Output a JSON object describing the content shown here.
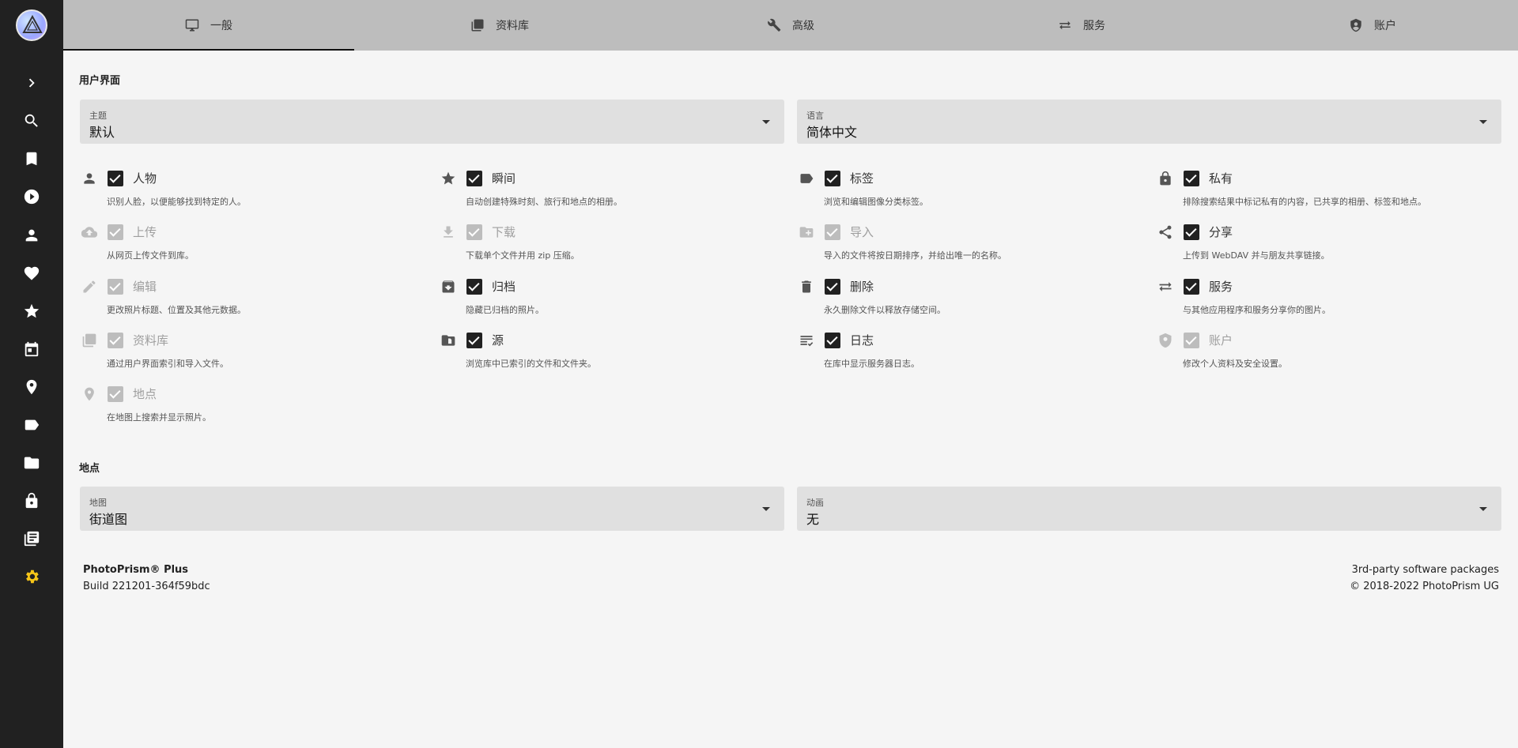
{
  "tabs": [
    {
      "label": "一般",
      "icon": "monitor-icon"
    },
    {
      "label": "资料库",
      "icon": "library-icon"
    },
    {
      "label": "高级",
      "icon": "wrench-icon"
    },
    {
      "label": "服务",
      "icon": "swap-icon"
    },
    {
      "label": "账户",
      "icon": "account-shield-icon"
    }
  ],
  "ui_section": {
    "title": "用户界面",
    "theme": {
      "label": "主题",
      "value": "默认"
    },
    "language": {
      "label": "语言",
      "value": "简体中文"
    }
  },
  "features": [
    {
      "title": "人物",
      "desc": "识别人脸，以便能够找到特定的人。",
      "icon": "person-icon",
      "enabled": true
    },
    {
      "title": "瞬间",
      "desc": "自动创建特殊时刻、旅行和地点的相册。",
      "icon": "star-icon",
      "enabled": true
    },
    {
      "title": "标签",
      "desc": "浏览和编辑图像分类标签。",
      "icon": "label-icon",
      "enabled": true
    },
    {
      "title": "私有",
      "desc": "排除搜索结果中标记私有的内容，已共享的相册、标签和地点。",
      "icon": "lock-icon",
      "enabled": true
    },
    {
      "title": "上传",
      "desc": "从网页上传文件到库。",
      "icon": "cloud-upload-icon",
      "enabled": false
    },
    {
      "title": "下载",
      "desc": "下载单个文件并用 zip 压缩。",
      "icon": "download-icon",
      "enabled": false
    },
    {
      "title": "导入",
      "desc": "导入的文件将按日期排序，并给出唯一的名称。",
      "icon": "folder-plus-icon",
      "enabled": false
    },
    {
      "title": "分享",
      "desc": "上传到 WebDAV 并与朋友共享链接。",
      "icon": "share-icon",
      "enabled": true
    },
    {
      "title": "编辑",
      "desc": "更改照片标题、位置及其他元数据。",
      "icon": "pencil-icon",
      "enabled": false
    },
    {
      "title": "归档",
      "desc": "隐藏已归档的照片。",
      "icon": "archive-icon",
      "enabled": true
    },
    {
      "title": "删除",
      "desc": "永久删除文件以释放存储空间。",
      "icon": "trash-icon",
      "enabled": true
    },
    {
      "title": "服务",
      "desc": "与其他应用程序和服务分享你的图片。",
      "icon": "swap-icon",
      "enabled": true
    },
    {
      "title": "资料库",
      "desc": "通过用户界面索引和导入文件。",
      "icon": "library-icon",
      "enabled": false
    },
    {
      "title": "源",
      "desc": "浏览库中已索引的文件和文件夹。",
      "icon": "folder-file-icon",
      "enabled": true
    },
    {
      "title": "日志",
      "desc": "在库中显示服务器日志。",
      "icon": "log-icon",
      "enabled": true
    },
    {
      "title": "账户",
      "desc": "修改个人资料及安全设置。",
      "icon": "account-shield-icon",
      "enabled": false
    },
    {
      "title": "地点",
      "desc": "在地图上搜索并显示照片。",
      "icon": "map-marker-icon",
      "enabled": false
    }
  ],
  "places_section": {
    "title": "地点",
    "map": {
      "label": "地图",
      "value": "街道图"
    },
    "animation": {
      "label": "动画",
      "value": "无"
    }
  },
  "footer": {
    "brand": "PhotoPrism® Plus",
    "build": "Build 221201-364f59bdc",
    "third_party": "3rd-party software packages",
    "copyright": "© 2018-2022 PhotoPrism UG"
  },
  "colors": {
    "accent": "#f5c518",
    "sidebar": "#212121",
    "tabs": "#bdbdbd"
  }
}
